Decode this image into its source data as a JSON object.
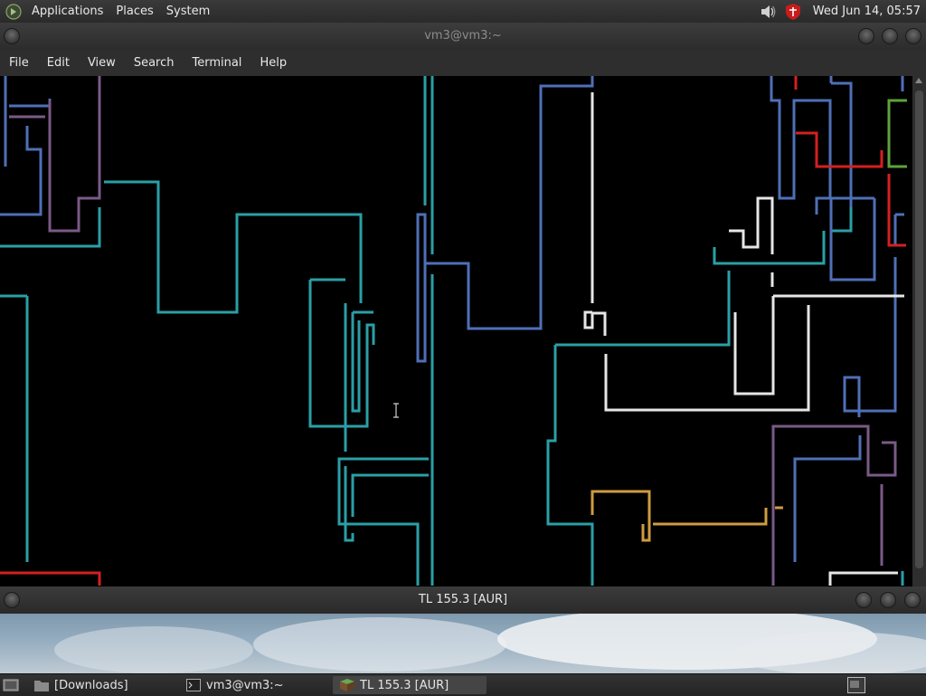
{
  "top_panel": {
    "menus": [
      "Applications",
      "Places",
      "System"
    ],
    "clock": "Wed Jun 14, 05:57",
    "icons": [
      "distro-logo-icon",
      "volume-icon",
      "security-shield-icon"
    ]
  },
  "terminal": {
    "title": "vm3@vm3:~",
    "menus": [
      "File",
      "Edit",
      "View",
      "Search",
      "Terminal",
      "Help"
    ],
    "content": "pipes-screensaver"
  },
  "tl_window": {
    "title": "TL 155.3 [AUR]"
  },
  "taskbar": {
    "items": [
      {
        "label": "[Downloads]",
        "icon": "folder-icon"
      },
      {
        "label": "vm3@vm3:~",
        "icon": "terminal-icon"
      },
      {
        "label": "TL 155.3 [AUR]",
        "icon": "minecraft-block-icon"
      }
    ]
  },
  "colors": {
    "teal": "#2a9fa6",
    "blue": "#4f6fb8",
    "white": "#e6e6e6",
    "red": "#d42020",
    "purple": "#7a5a86",
    "orange": "#cf9b3f",
    "green": "#5fa23a"
  }
}
